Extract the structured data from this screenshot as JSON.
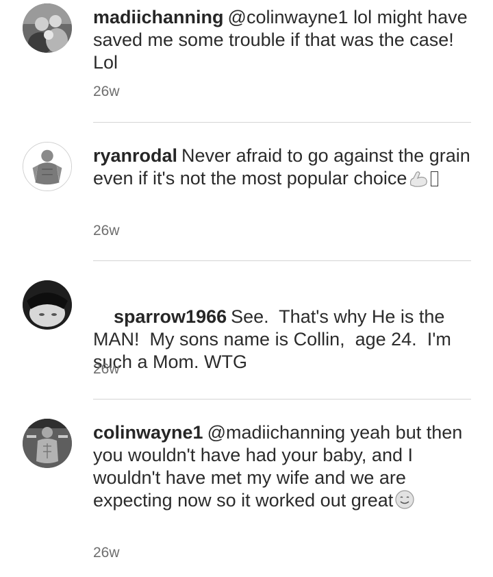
{
  "comments": [
    {
      "username": "madiichanning",
      "mention": "@colinwayne1",
      "text": "lol might have saved me some trouble if that was the case! Lol",
      "time": "26w"
    },
    {
      "username": "ryanrodal",
      "mention": "",
      "text": "Never afraid to go against the grain even if it's not the most popular choice",
      "emoji": "flexed-biceps",
      "time": "26w"
    },
    {
      "username": "sparrow1966",
      "mention": "",
      "text": "See.  That's why He is the MAN!  My sons name is Collin,  age 24.  I'm such a Mom. WTG",
      "time": "26w"
    },
    {
      "username": "colinwayne1",
      "mention": "@madiichanning",
      "text": "yeah but then you wouldn't have had your baby, and I wouldn't have met my wife and we are expecting now so it worked out great",
      "emoji": "smiling-face",
      "time": "26w"
    }
  ],
  "colors": {
    "text": "#262626",
    "timestamp": "#6e6e6e",
    "divider": "#d4d4d4"
  }
}
